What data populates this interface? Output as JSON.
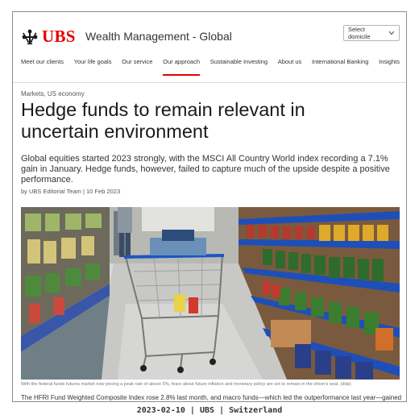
{
  "header": {
    "brand_name": "UBS",
    "site_title": "Wealth Management - Global",
    "domicile_label": "Select domicile",
    "nav": [
      {
        "label": "Meet our clients"
      },
      {
        "label": "Your life goals"
      },
      {
        "label": "Our service"
      },
      {
        "label": "Our approach",
        "active": true
      },
      {
        "label": "Sustainable Investing"
      },
      {
        "label": "About us"
      },
      {
        "label": "International Banking"
      },
      {
        "label": "Insights"
      }
    ]
  },
  "article": {
    "breadcrumb": "Markets, US economy",
    "headline": "Hedge funds to remain relevant in uncertain environment",
    "lede": "Global equities started 2023 strongly, with the MSCI All Country World index recording a 7.1% gain in January. Hedge funds, however, failed to capture much of the upside despite a positive performance.",
    "byline": "by UBS Editorial Team | 10 Feb 2023",
    "hero_image": "supermarket-aisle-shopping-cart",
    "caption": "With the federal funds futures market now pricing a peak rate of above 5%, fears about future inflation and monetary policy are set to remain in the driver's seat. (ddp)",
    "body_first_line": "The HFRI Fund Weighted Composite Index rose 2.8% last month, and macro funds—which led the outperformance last year—gained"
  },
  "footer": {
    "stamp": "2023-02-10 | UBS | Switzerland"
  },
  "colors": {
    "brand_red": "#e60000",
    "shelf_blue": "#1e4fb8"
  }
}
